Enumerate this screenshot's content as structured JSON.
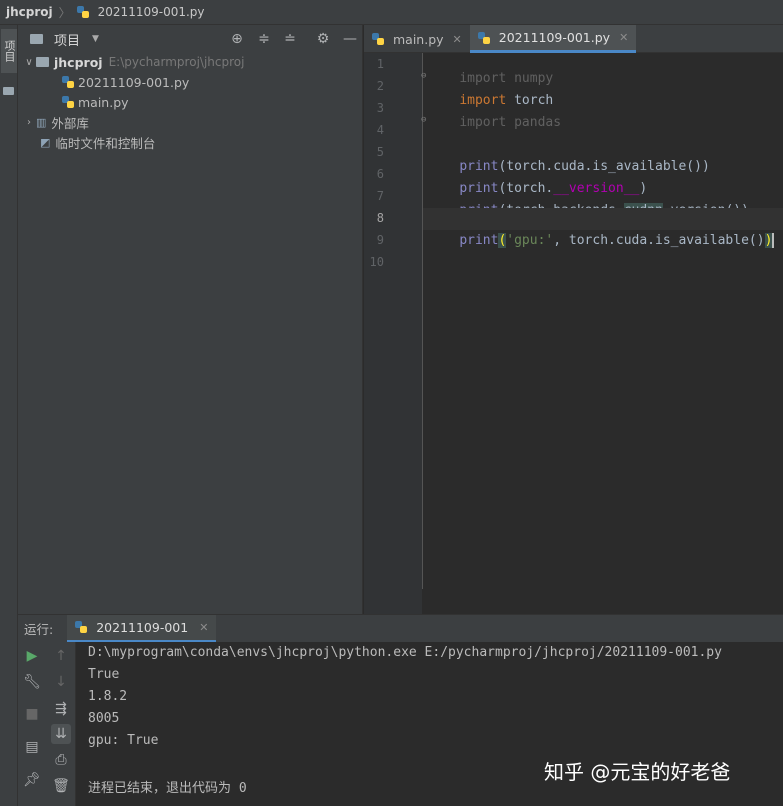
{
  "breadcrumb": {
    "project": "jhcproj",
    "separator": "〉",
    "file": "20211109-001.py"
  },
  "left_strip": {
    "tab_label": "项目"
  },
  "project_panel": {
    "title": "项目",
    "tree": {
      "root_name": "jhcproj",
      "root_path": "E:\\pycharmproj\\jhcproj",
      "files": [
        "20211109-001.py",
        "main.py"
      ],
      "external_libs": "外部库",
      "scratches": "临时文件和控制台"
    }
  },
  "editor_tabs": [
    {
      "label": "main.py",
      "close": "✕"
    },
    {
      "label": "20211109-001.py",
      "close": "✕"
    }
  ],
  "line_numbers": [
    "1",
    "2",
    "3",
    "4",
    "5",
    "6",
    "7",
    "8",
    "9",
    "10"
  ],
  "code": {
    "l1_kw": "import",
    "l1_rest": " numpy",
    "l2_kw": "import",
    "l2_rest": " torch",
    "l3_kw": "import",
    "l3_rest": " pandas",
    "l5_fn": "print",
    "l5_rest": "(torch.cuda.is_available())",
    "l6_fn": "print",
    "l6_a": "(torch.",
    "l6_dunder": "__version__",
    "l6_b": ")",
    "l7_fn": "print",
    "l7_a": "(torch.backends.",
    "l7_hl": "cudnn",
    "l7_b": ".version())",
    "l8_fn": "print",
    "l8_open": "(",
    "l8_str": "'gpu:'",
    "l8_mid": ", torch.cuda.is_available()",
    "l8_close": ")"
  },
  "run_panel": {
    "label": "运行:",
    "tab": "20211109-001",
    "close": "✕",
    "output": [
      "D:\\myprogram\\conda\\envs\\jhcproj\\python.exe E:/pycharmproj/jhcproj/20211109-001.py",
      "True",
      "1.8.2",
      "8005",
      "gpu: True",
      "",
      "进程已结束，退出代码为 0"
    ]
  },
  "watermark": "知乎 @元宝的好老爸",
  "colors": {
    "accent": "#4a88c7",
    "keyword": "#cc7832",
    "string": "#6a8759",
    "builtin": "#8888c6",
    "dunder": "#b200b2",
    "run": "#59a869"
  }
}
